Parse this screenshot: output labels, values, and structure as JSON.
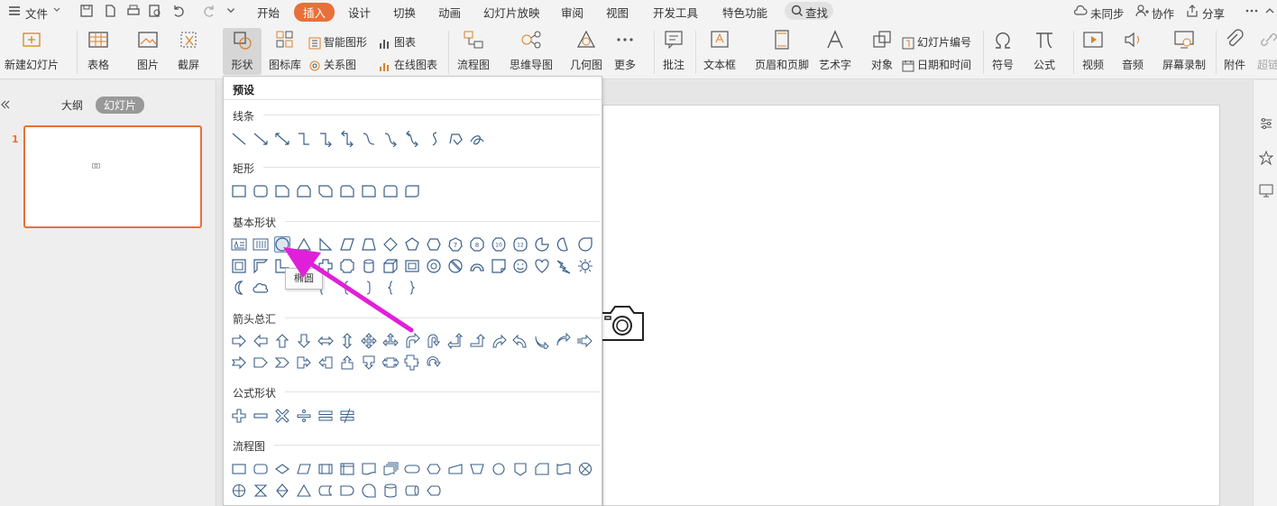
{
  "menubar": {
    "file_label": "文件",
    "tabs": [
      "开始",
      "插入",
      "设计",
      "切换",
      "动画",
      "幻灯片放映",
      "审阅",
      "视图",
      "开发工具",
      "特色功能"
    ],
    "active_tab": "插入",
    "search_label": "查找",
    "sync_label": "未同步",
    "collab_label": "协作",
    "share_label": "分享"
  },
  "ribbon": {
    "new_slide": "新建幻灯片",
    "table": "表格",
    "picture": "图片",
    "screenshot": "截屏",
    "shape": "形状",
    "icon_lib": "图标库",
    "smart_art": "智能图形",
    "chart": "图表",
    "relation": "关系图",
    "online_chart": "在线图表",
    "flowchart": "流程图",
    "mindmap": "思维导图",
    "geometry": "几何图",
    "more": "更多",
    "comment": "批注",
    "textbox": "文本框",
    "header_footer": "页眉和页脚",
    "wordart": "艺术字",
    "object": "对象",
    "slide_number": "幻灯片编号",
    "datetime": "日期和时间",
    "symbol": "符号",
    "formula": "公式",
    "video": "视频",
    "audio": "音频",
    "screen_record": "屏幕录制",
    "attachment": "附件",
    "hyperlink": "超链"
  },
  "left_panel": {
    "tab_outline": "大纲",
    "tab_slides": "幻灯片",
    "slide_number": "1"
  },
  "dropdown": {
    "header": "预设",
    "sections": [
      "线条",
      "矩形",
      "基本形状",
      "箭头总汇",
      "公式形状",
      "流程图"
    ],
    "tooltip": "椭圆"
  },
  "colors": {
    "accent": "#e8703a",
    "arrow": "#e020d8",
    "shape_stroke": "#3a5f8a"
  }
}
